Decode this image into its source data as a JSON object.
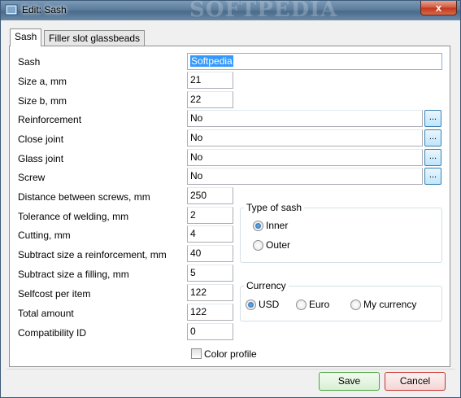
{
  "window": {
    "title": "Edit: Sash",
    "watermark": "SOFTPEDIA",
    "close_glyph": "x"
  },
  "tabs": [
    {
      "label": "Sash",
      "active": true
    },
    {
      "label": "Filler slot glassbeads",
      "active": false
    }
  ],
  "form": {
    "sash": {
      "label": "Sash",
      "value": "Softpedia"
    },
    "size_a": {
      "label": "Size a, mm",
      "value": "21"
    },
    "size_b": {
      "label": "Size b, mm",
      "value": "22"
    },
    "reinforcement": {
      "label": "Reinforcement",
      "value": "No"
    },
    "close_joint": {
      "label": "Close joint",
      "value": "No"
    },
    "glass_joint": {
      "label": "Glass joint",
      "value": "No"
    },
    "screw": {
      "label": "Screw",
      "value": "No"
    },
    "distance_screws": {
      "label": "Distance between screws, mm",
      "value": "250"
    },
    "tolerance_welding": {
      "label": "Tolerance of welding, mm",
      "value": "2"
    },
    "cutting": {
      "label": "Cutting, mm",
      "value": "4"
    },
    "subtract_reinforcement": {
      "label": "Subtract size a reinforcement, mm",
      "value": "40"
    },
    "subtract_filling": {
      "label": "Subtract size a filling, mm",
      "value": "5"
    },
    "selfcost": {
      "label": "Selfcost per item",
      "value": "122"
    },
    "total_amount": {
      "label": "Total amount",
      "value": "122"
    },
    "compatibility_id": {
      "label": "Compatibility ID",
      "value": "0"
    },
    "browse_label": "..."
  },
  "type_of_sash": {
    "title": "Type of sash",
    "options": [
      {
        "label": "Inner",
        "checked": true
      },
      {
        "label": "Outer",
        "checked": false
      }
    ]
  },
  "currency": {
    "title": "Currency",
    "options": [
      {
        "label": "USD",
        "checked": true
      },
      {
        "label": "Euro",
        "checked": false
      },
      {
        "label": "My currency",
        "checked": false
      }
    ]
  },
  "color_profile": {
    "label": "Color profile",
    "checked": false
  },
  "buttons": {
    "save": "Save",
    "cancel": "Cancel"
  },
  "colors": {
    "save_border": "#48a63c",
    "cancel_border": "#c7312d",
    "title_bar": "#5b7c9c"
  }
}
